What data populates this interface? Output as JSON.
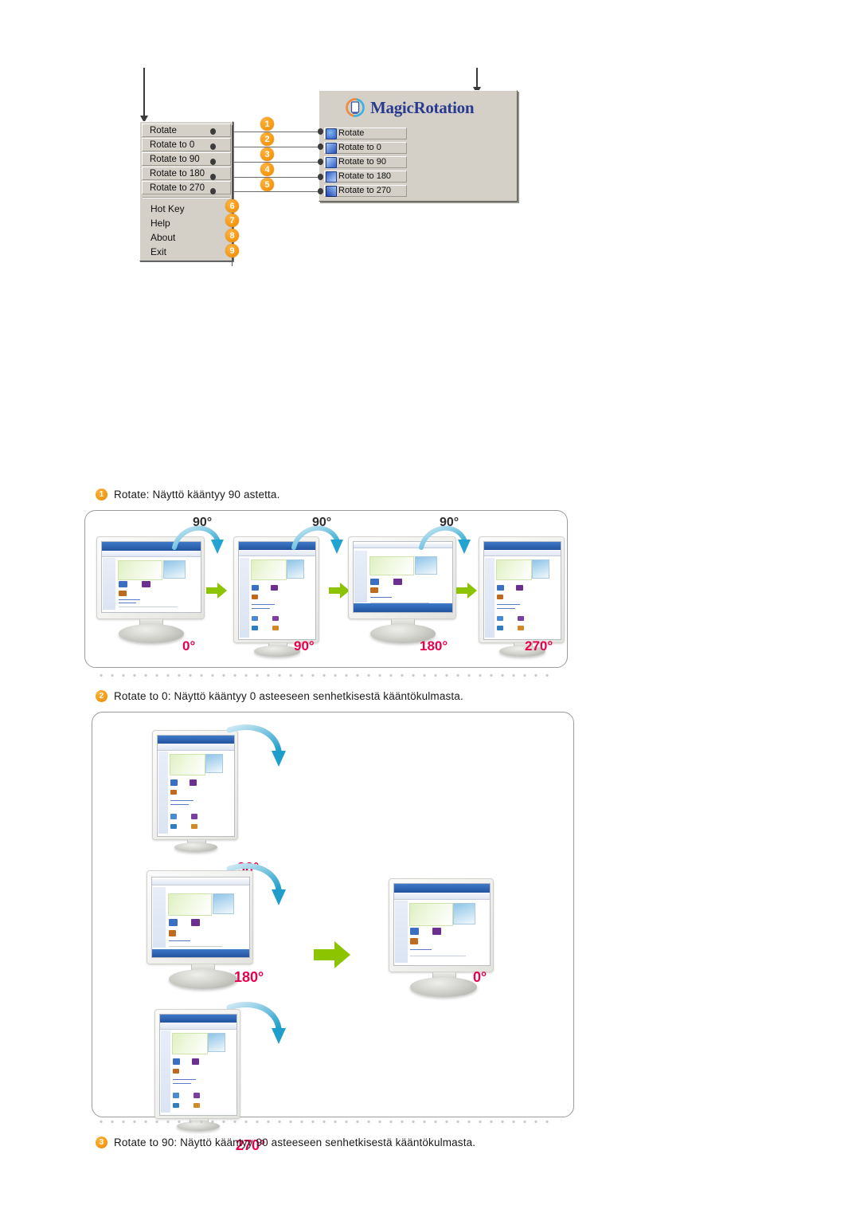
{
  "diagram": {
    "context_menu": {
      "name": "MagicRotation tray context menu",
      "boxed_items": [
        {
          "label": "Rotate"
        },
        {
          "label": "Rotate to 0"
        },
        {
          "label": "Rotate to 90"
        },
        {
          "label": "Rotate to 180"
        },
        {
          "label": "Rotate to 270"
        }
      ],
      "plain_items": [
        {
          "label": "Hot Key"
        },
        {
          "label": "Help"
        },
        {
          "label": "About"
        },
        {
          "label": "Exit"
        }
      ]
    },
    "panel": {
      "logo_text": "MagicRotation",
      "items": [
        {
          "label": "Rotate",
          "icon": "rotate-icon",
          "icon_color": "#3a63c8"
        },
        {
          "label": "Rotate to 0",
          "icon": "rotate-0-icon",
          "icon_color": "#2b53b8"
        },
        {
          "label": "Rotate to 90",
          "icon": "rotate-90-icon",
          "icon_color": "#2f5ec4"
        },
        {
          "label": "Rotate to 180",
          "icon": "rotate-180-icon",
          "icon_color": "#2f5ec4"
        },
        {
          "label": "Rotate to 270",
          "icon": "rotate-270-icon",
          "icon_color": "#2040b0"
        }
      ]
    },
    "callout_numbers": [
      "1",
      "2",
      "3",
      "4",
      "5",
      "6",
      "7",
      "8",
      "9"
    ]
  },
  "sections": [
    {
      "number": "1",
      "caption": "Rotate:  Näyttö kääntyy 90 astetta.",
      "illustration": {
        "type": "rotation-sequence-horizontal",
        "rotation_arrows": [
          "90°",
          "90°",
          "90°"
        ],
        "monitor_labels": [
          "0°",
          "90°",
          "180°",
          "270°"
        ]
      }
    },
    {
      "number": "2",
      "caption": "Rotate to 0: Näyttö kääntyy 0 asteeseen senhetkisestä kääntökulmasta.",
      "illustration": {
        "type": "rotation-to-zero",
        "rotation_arrows": [
          "90°"
        ],
        "source_labels": [
          "90°",
          "180°",
          "270°"
        ],
        "target_label": "0°"
      }
    },
    {
      "number": "3",
      "caption": "Rotate to 90: Näyttö kääntyy 90 asteeseen senhetkisestä kääntökulmasta."
    }
  ],
  "colors": {
    "badge_orange": "#F79C16",
    "degree_pink": "#E8004C",
    "arrow_green": "#8DC400",
    "curve_blue": "#2FA8D0",
    "logo_blue": "#2A3B8F",
    "panel_gray": "#D4D0C8",
    "panel_border": "#9B9B9B",
    "dot_gray": "#C9C9C9"
  }
}
